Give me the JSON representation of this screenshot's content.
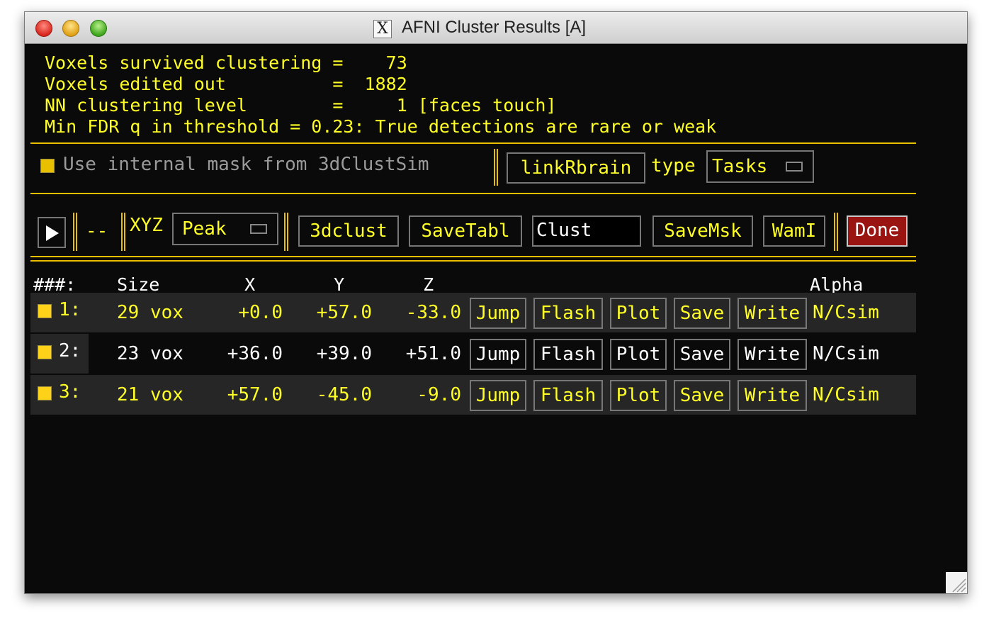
{
  "window": {
    "title": "AFNI Cluster Results [A]"
  },
  "summary": {
    "line1": "Voxels survived clustering =    73",
    "line2": "Voxels edited out          =  1882",
    "line3": "NN clustering level        =     1 [faces touch]",
    "line4": "Min FDR q in threshold = 0.23: True detections are rare or weak"
  },
  "mask_row": {
    "mask_label": "Use internal mask from 3dClustSim",
    "link_button": "linkRbrain",
    "type_label": "type",
    "type_value": "Tasks"
  },
  "toolbar": {
    "dash_label": "--",
    "xyz_label": "XYZ",
    "xyz_value": "Peak",
    "clust3d_button": "3dclust",
    "savetabl_button": "SaveTabl",
    "prefix_value": "Clust",
    "savemsk_button": "SaveMsk",
    "wami_button": "WamI",
    "done_button": "Done"
  },
  "table": {
    "header_idx": "###:",
    "header_size": "__Size__",
    "header_x": "__X__",
    "header_y": "__Y__",
    "header_z": "__Z__",
    "header_alpha": "Alpha",
    "buttons": {
      "jump": "Jump",
      "flash": "Flash",
      "plot": "Plot",
      "save": "Save",
      "write": "Write"
    },
    "rows": [
      {
        "idx": "1:",
        "size": "29 vox",
        "x": "+0.0",
        "y": "+57.0",
        "z": "-33.0",
        "alpha": "N/Csim"
      },
      {
        "idx": "2:",
        "size": "23 vox",
        "x": "+36.0",
        "y": "+39.0",
        "z": "+51.0",
        "alpha": "N/Csim"
      },
      {
        "idx": "3:",
        "size": "21 vox",
        "x": "+57.0",
        "y": "-45.0",
        "z": "-9.0",
        "alpha": "N/Csim"
      }
    ]
  },
  "colors": {
    "accent": "#ffff26",
    "separator": "#e8c000",
    "done": "#9a1512",
    "background": "#0a0a0a"
  }
}
